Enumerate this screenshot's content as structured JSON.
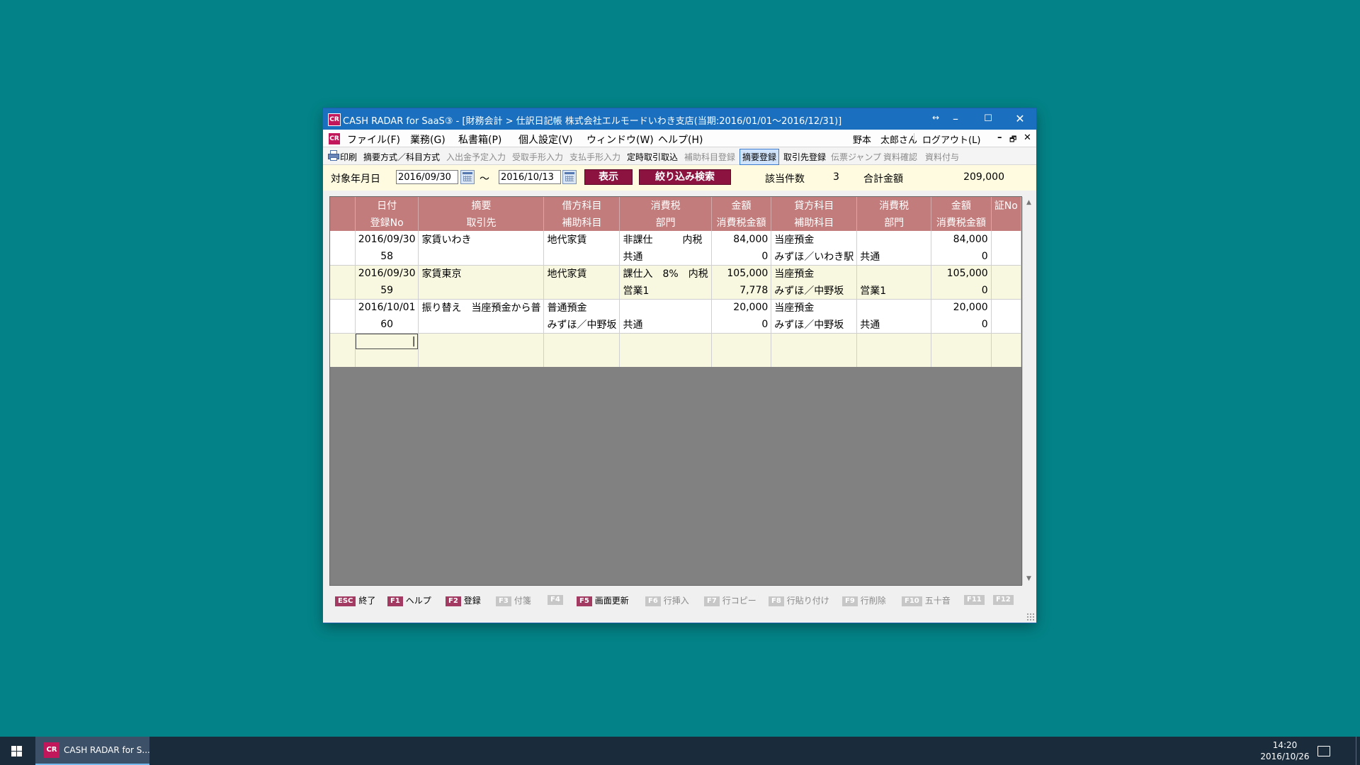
{
  "window": {
    "title": "CASH RADAR for SaaS③ - [財務会計 > 仕訳日記帳 株式会社エルモードいわき支店(当期:2016/01/01〜2016/12/31)]",
    "app_badge": "CR",
    "controls": {
      "restore_hint": "↔",
      "minimize": "–",
      "maximize": "☐",
      "close": "✕"
    }
  },
  "menubar": {
    "items": [
      "ファイル(F)",
      "業務(G)",
      "私書箱(P)",
      "個人設定(V)",
      "ウィンドウ(W)",
      "ヘルプ(H)"
    ],
    "user": "野本　太郎さん",
    "logout": "ログアウト(L)",
    "mdi_controls": {
      "minimize": "–",
      "restore": "🗗",
      "close": "✕"
    }
  },
  "toolbar": {
    "items": [
      {
        "label": "印刷",
        "state": "enabled",
        "icon": "printer-icon"
      },
      {
        "label": "摘要方式／科目方式",
        "state": "enabled"
      },
      {
        "label": "入出金予定入力",
        "state": "disabled"
      },
      {
        "label": "受取手形入力",
        "state": "disabled"
      },
      {
        "label": "支払手形入力",
        "state": "disabled"
      },
      {
        "label": "定時取引取込",
        "state": "enabled"
      },
      {
        "label": "補助科目登録",
        "state": "disabled"
      },
      {
        "label": "摘要登録",
        "state": "active"
      },
      {
        "label": "取引先登録",
        "state": "enabled"
      },
      {
        "label": "伝票ジャンプ",
        "state": "disabled"
      },
      {
        "label": "資料確認",
        "state": "disabled"
      },
      {
        "label": "資料付与",
        "state": "disabled"
      }
    ]
  },
  "filter": {
    "date_label": "対象年月日",
    "date_from": "2016/09/30",
    "tilde": "～",
    "date_to": "2016/10/13",
    "show_button": "表示",
    "search_button": "絞り込み検索",
    "count_label": "該当件数",
    "count_value": "3",
    "total_label": "合計金額",
    "total_value": "209,000"
  },
  "table": {
    "headers_top": [
      "",
      "日付",
      "摘要",
      "借方科目",
      "消費税",
      "金額",
      "貸方科目",
      "消費税",
      "金額",
      "証No"
    ],
    "headers_bottom": [
      "",
      "登録No",
      "取引先",
      "補助科目",
      "部門",
      "消費税金額",
      "補助科目",
      "部門",
      "消費税金額",
      ""
    ],
    "rows": [
      {
        "top": [
          "",
          "2016/09/30",
          "家賃いわき",
          "地代家賃",
          "非課仕　　　内税",
          "84,000",
          "当座預金",
          "",
          "84,000",
          ""
        ],
        "bottom": [
          "",
          "58",
          "",
          "",
          "共通",
          "0",
          "みずほ／いわき駅",
          "共通",
          "0",
          ""
        ]
      },
      {
        "top": [
          "",
          "2016/09/30",
          "家賃東京",
          "地代家賃",
          "課仕入　8%　内税",
          "105,000",
          "当座預金",
          "",
          "105,000",
          ""
        ],
        "bottom": [
          "",
          "59",
          "",
          "",
          "営業1",
          "7,778",
          "みずほ／中野坂",
          "営業1",
          "0",
          ""
        ]
      },
      {
        "top": [
          "",
          "2016/10/01",
          "振り替え　当座預金から普",
          "普通預金",
          "",
          "20,000",
          "当座預金",
          "",
          "20,000",
          ""
        ],
        "bottom": [
          "",
          "60",
          "",
          "みずほ／中野坂",
          "共通",
          "0",
          "みずほ／中野坂",
          "共通",
          "0",
          ""
        ]
      },
      {
        "top": [
          "",
          "|",
          "",
          "",
          "",
          "",
          "",
          "",
          "",
          ""
        ],
        "bottom": [
          "",
          "",
          "",
          "",
          "",
          "",
          "",
          "",
          "",
          ""
        ]
      }
    ]
  },
  "fkeys": [
    {
      "key": "ESC",
      "label": "終了",
      "enabled": true
    },
    {
      "key": "F1",
      "label": "ヘルプ",
      "enabled": true
    },
    {
      "key": "F2",
      "label": "登録",
      "enabled": true
    },
    {
      "key": "F3",
      "label": "付箋",
      "enabled": false
    },
    {
      "key": "F4",
      "label": "",
      "enabled": false
    },
    {
      "key": "F5",
      "label": "画面更新",
      "enabled": true
    },
    {
      "key": "F6",
      "label": "行挿入",
      "enabled": false
    },
    {
      "key": "F7",
      "label": "行コピー",
      "enabled": false
    },
    {
      "key": "F8",
      "label": "行貼り付け",
      "enabled": false
    },
    {
      "key": "F9",
      "label": "行削除",
      "enabled": false
    },
    {
      "key": "F10",
      "label": "五十音",
      "enabled": false
    },
    {
      "key": "F11",
      "label": "",
      "enabled": false
    },
    {
      "key": "F12",
      "label": "",
      "enabled": false
    }
  ],
  "taskbar": {
    "app_label": "CASH RADAR for S...",
    "app_icon_text": "CR",
    "time": "14:20",
    "date": "2016/10/26"
  },
  "colors": {
    "desktop": "#038387",
    "titlebar": "#1a6fbf",
    "header": "#c27c7c",
    "button": "#8c1340",
    "row_alt": "#f8f7e0"
  }
}
